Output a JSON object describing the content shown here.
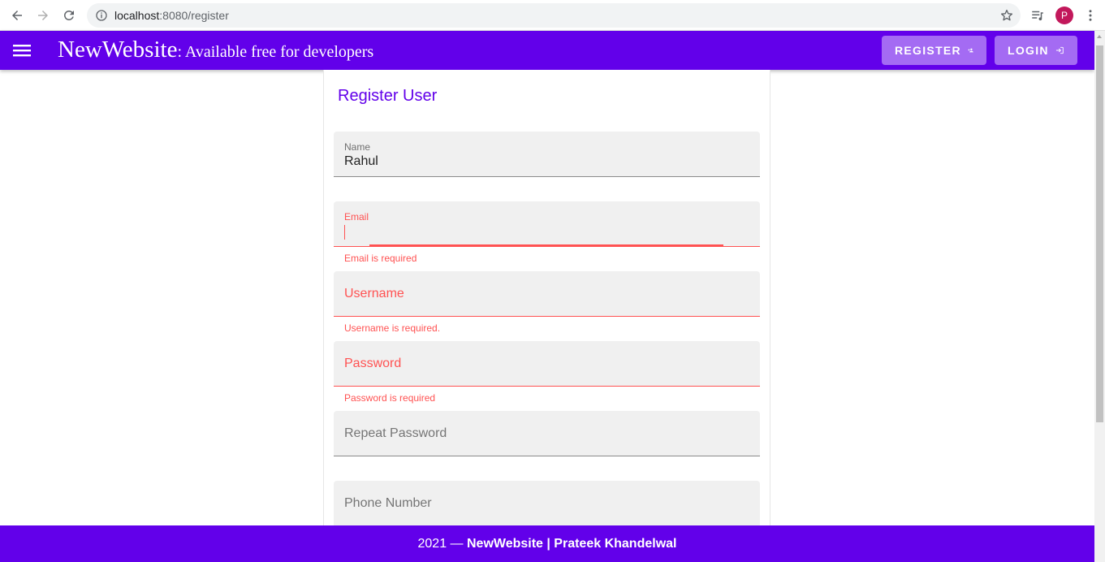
{
  "browser": {
    "url_host": "localhost",
    "url_path": ":8080/register",
    "profile_initial": "P"
  },
  "app_bar": {
    "brand_name": "NewWebsite",
    "tagline": ": Available free for developers",
    "register_label": "REGISTER",
    "login_label": "LOGIN"
  },
  "form": {
    "title": "Register User",
    "name_label": "Name",
    "name_value": "Rahul",
    "email_label": "Email",
    "email_error": "Email is required",
    "username_label": "Username",
    "username_error": "Username is required.",
    "password_label": "Password",
    "password_error": "Password is required",
    "repeat_password_label": "Repeat Password",
    "phone_label": "Phone Number"
  },
  "footer": {
    "year": "2021",
    "dash": " — ",
    "credit": "NewWebsite | Prateek Khandelwal"
  },
  "colors": {
    "primary": "#6200ea",
    "error": "#ff5252",
    "field_bg": "#f0f0f0"
  }
}
